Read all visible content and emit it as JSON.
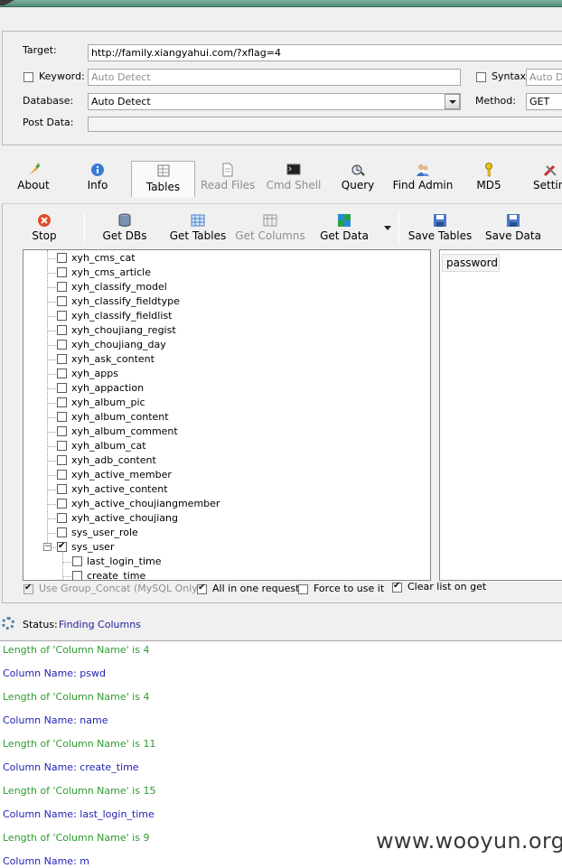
{
  "form": {
    "target_label": "Target:",
    "target_value": "http://family.xiangyahui.com/?xflag=4",
    "keyword_label": "Keyword:",
    "keyword_placeholder": "Auto Detect",
    "syntax_label": "Syntax:",
    "syntax_placeholder": "Auto D",
    "database_label": "Database:",
    "database_value": "Auto Detect",
    "method_label": "Method:",
    "method_value": "GET",
    "postdata_label": "Post Data:"
  },
  "main_toolbar": [
    {
      "label": "About",
      "icon": "carrot-icon"
    },
    {
      "label": "Info",
      "icon": "info-icon"
    },
    {
      "label": "Tables",
      "icon": "table-icon",
      "selected": true
    },
    {
      "label": "Read Files",
      "icon": "file-icon",
      "disabled": true
    },
    {
      "label": "Cmd Shell",
      "icon": "terminal-icon",
      "disabled": true
    },
    {
      "label": "Query",
      "icon": "query-icon"
    },
    {
      "label": "Find Admin",
      "icon": "users-icon"
    },
    {
      "label": "MD5",
      "icon": "key-icon"
    },
    {
      "label": "Settin",
      "icon": "tools-icon"
    }
  ],
  "tables_toolbar": [
    {
      "label": "Stop",
      "icon": "stop-icon"
    },
    {
      "label": "Get DBs",
      "icon": "database-icon"
    },
    {
      "label": "Get Tables",
      "icon": "grid-icon"
    },
    {
      "label": "Get Columns",
      "icon": "columns-icon",
      "disabled": true
    },
    {
      "label": "Get Data",
      "icon": "data-icon"
    },
    {
      "label": "Save Tables",
      "icon": "save-icon"
    },
    {
      "label": "Save Data",
      "icon": "save-icon"
    }
  ],
  "tree": {
    "tables": [
      {
        "name": "xyh_cms_cat",
        "checked": false
      },
      {
        "name": "xyh_cms_article",
        "checked": false
      },
      {
        "name": "xyh_classify_model",
        "checked": false
      },
      {
        "name": "xyh_classify_fieldtype",
        "checked": false
      },
      {
        "name": "xyh_classify_fieldlist",
        "checked": false
      },
      {
        "name": "xyh_choujiang_regist",
        "checked": false
      },
      {
        "name": "xyh_choujiang_day",
        "checked": false
      },
      {
        "name": "xyh_ask_content",
        "checked": false
      },
      {
        "name": "xyh_apps",
        "checked": false
      },
      {
        "name": "xyh_appaction",
        "checked": false
      },
      {
        "name": "xyh_album_pic",
        "checked": false
      },
      {
        "name": "xyh_album_content",
        "checked": false
      },
      {
        "name": "xyh_album_comment",
        "checked": false
      },
      {
        "name": "xyh_album_cat",
        "checked": false
      },
      {
        "name": "xyh_adb_content",
        "checked": false
      },
      {
        "name": "xyh_active_member",
        "checked": false
      },
      {
        "name": "xyh_active_content",
        "checked": false
      },
      {
        "name": "xyh_active_choujiangmember",
        "checked": false
      },
      {
        "name": "xyh_active_choujiang",
        "checked": false
      },
      {
        "name": "sys_user_role",
        "checked": false
      },
      {
        "name": "sys_user",
        "checked": true,
        "expanded": true
      }
    ],
    "columns": [
      {
        "name": "last_login_time",
        "checked": false
      },
      {
        "name": "create_time",
        "checked": false
      }
    ]
  },
  "column_list": {
    "header": "password"
  },
  "options": {
    "group_concat": "Use Group_Concat (MySQL Only)",
    "all_in_one": "All in one request.",
    "force": "Force to use it",
    "clear_list": "Clear list on get"
  },
  "status": {
    "label": "Status:",
    "value": "Finding Columns"
  },
  "log": [
    {
      "text": "Length of 'Column Name' is 4",
      "color": "#2e9b2e"
    },
    {
      "text": "Column Name: pswd",
      "color": "#1f1fb4"
    },
    {
      "text": "Length of 'Column Name' is 4",
      "color": "#2e9b2e"
    },
    {
      "text": "Column Name: name",
      "color": "#1f1fb4"
    },
    {
      "text": "Length of 'Column Name' is 11",
      "color": "#2e9b2e"
    },
    {
      "text": "Column Name: create_time",
      "color": "#1f1fb4"
    },
    {
      "text": "Length of 'Column Name' is 15",
      "color": "#2e9b2e"
    },
    {
      "text": "Column Name: last_login_time",
      "color": "#1f1fb4"
    },
    {
      "text": "Length of 'Column Name' is 9",
      "color": "#2e9b2e"
    },
    {
      "text": "Column Name: m",
      "color": "#1f1fb4"
    }
  ],
  "watermark": "www.wooyun.org"
}
